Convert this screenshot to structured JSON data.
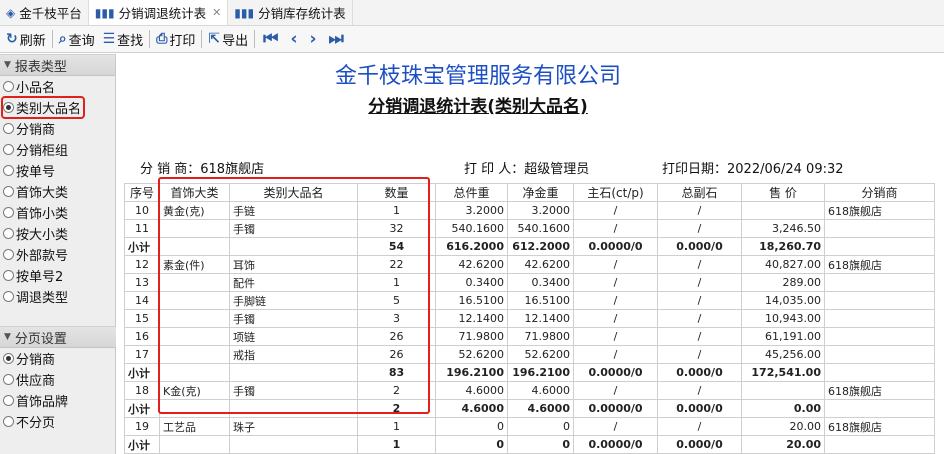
{
  "tabs": [
    {
      "label": "金千枝平台",
      "icon": "logo-icon"
    },
    {
      "label": "分销调退统计表",
      "icon": "bar-chart-icon",
      "active": true,
      "closable": true
    },
    {
      "label": "分销库存统计表",
      "icon": "bar-chart-icon"
    }
  ],
  "toolbar": {
    "refresh": "刷新",
    "query": "查询",
    "find": "查找",
    "print": "打印",
    "export": "导出"
  },
  "left_panel": {
    "group1_title": "报表类型",
    "group1_items": [
      "小品名",
      "类别大品名",
      "分销商",
      "分销柜组",
      "按单号",
      "首饰大类",
      "首饰小类",
      "按大小类",
      "外部款号",
      "按单号2",
      "调退类型"
    ],
    "group1_selected": 1,
    "group2_title": "分页设置",
    "group2_items": [
      "分销商",
      "供应商",
      "首饰品牌",
      "不分页"
    ],
    "group2_selected": 0
  },
  "report": {
    "company": "金千枝珠宝管理服务有限公司",
    "title": "分销调退统计表(类别大品名)",
    "distributor_label": "分 销 商：618旗舰店",
    "printer_label": "打 印 人：超级管理员",
    "print_date_label": "打印日期：2022/06/24 09:32",
    "columns": [
      "序号",
      "首饰大类",
      "类别大品名",
      "数量",
      "总件重",
      "净金重",
      "主石(ct/p)",
      "总副石",
      "售 价",
      "分销商"
    ],
    "rows": [
      {
        "type": "row",
        "cells": [
          "10",
          "黄金(克)",
          "手链",
          "1",
          "3.2000",
          "3.2000",
          "/",
          "/",
          "",
          "618旗舰店"
        ]
      },
      {
        "type": "row",
        "cells": [
          "11",
          "",
          "手镯",
          "32",
          "540.1600",
          "540.1600",
          "/",
          "/",
          "3,246.50",
          ""
        ]
      },
      {
        "type": "sub",
        "cells": [
          "小计",
          "",
          "",
          "54",
          "616.2000",
          "612.2000",
          "0.0000/0",
          "0.000/0",
          "18,260.70",
          ""
        ]
      },
      {
        "type": "row",
        "cells": [
          "12",
          "素金(件)",
          "耳饰",
          "22",
          "42.6200",
          "42.6200",
          "/",
          "/",
          "40,827.00",
          "618旗舰店"
        ]
      },
      {
        "type": "row",
        "cells": [
          "13",
          "",
          "配件",
          "1",
          "0.3400",
          "0.3400",
          "/",
          "/",
          "289.00",
          ""
        ]
      },
      {
        "type": "row",
        "cells": [
          "14",
          "",
          "手脚链",
          "5",
          "16.5100",
          "16.5100",
          "/",
          "/",
          "14,035.00",
          ""
        ]
      },
      {
        "type": "row",
        "cells": [
          "15",
          "",
          "手镯",
          "3",
          "12.1400",
          "12.1400",
          "/",
          "/",
          "10,943.00",
          ""
        ]
      },
      {
        "type": "row",
        "cells": [
          "16",
          "",
          "项链",
          "26",
          "71.9800",
          "71.9800",
          "/",
          "/",
          "61,191.00",
          ""
        ]
      },
      {
        "type": "row",
        "cells": [
          "17",
          "",
          "戒指",
          "26",
          "52.6200",
          "52.6200",
          "/",
          "/",
          "45,256.00",
          ""
        ]
      },
      {
        "type": "sub",
        "cells": [
          "小计",
          "",
          "",
          "83",
          "196.2100",
          "196.2100",
          "0.0000/0",
          "0.000/0",
          "172,541.00",
          ""
        ]
      },
      {
        "type": "row",
        "cells": [
          "18",
          "K金(克)",
          "手镯",
          "2",
          "4.6000",
          "4.6000",
          "/",
          "/",
          "",
          "618旗舰店"
        ]
      },
      {
        "type": "sub",
        "cells": [
          "小计",
          "",
          "",
          "2",
          "4.6000",
          "4.6000",
          "0.0000/0",
          "0.000/0",
          "0.00",
          ""
        ]
      },
      {
        "type": "row",
        "cells": [
          "19",
          "工艺品",
          "珠子",
          "1",
          "0",
          "0",
          "/",
          "/",
          "20.00",
          "618旗舰店"
        ]
      },
      {
        "type": "sub",
        "cells": [
          "小计",
          "",
          "",
          "1",
          "0",
          "0",
          "0.0000/0",
          "0.000/0",
          "20.00",
          ""
        ]
      }
    ]
  },
  "colors": {
    "accent": "#2a5ca8",
    "company": "#1d4fc4",
    "highlight": "#e0201b"
  }
}
